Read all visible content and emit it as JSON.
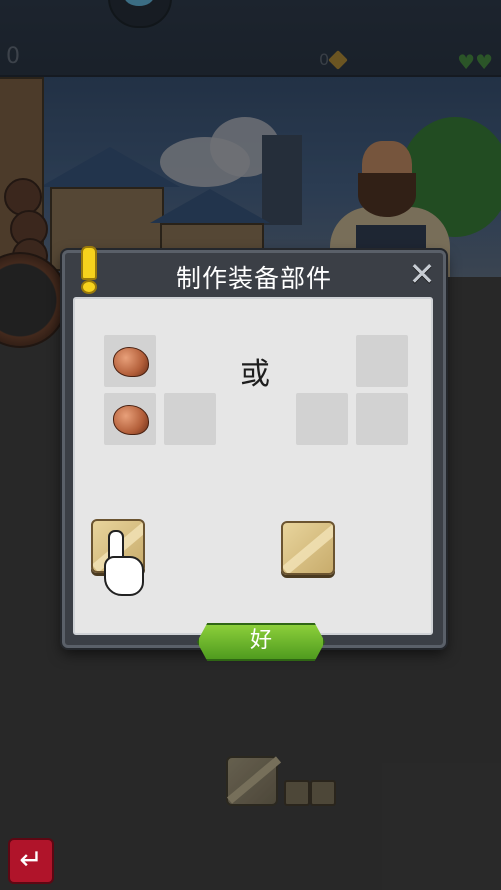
{
  "hud": {
    "left_counter": "0",
    "gold_amount": "0",
    "hearts": "♥♥"
  },
  "dialog": {
    "title": "制作装备部件",
    "or_label": "或",
    "ok_label": "好"
  },
  "back_button": "↵",
  "colors": {
    "ok_green": "#6ab42b",
    "back_red": "#b0142a",
    "alert_yellow": "#f6d21d"
  }
}
